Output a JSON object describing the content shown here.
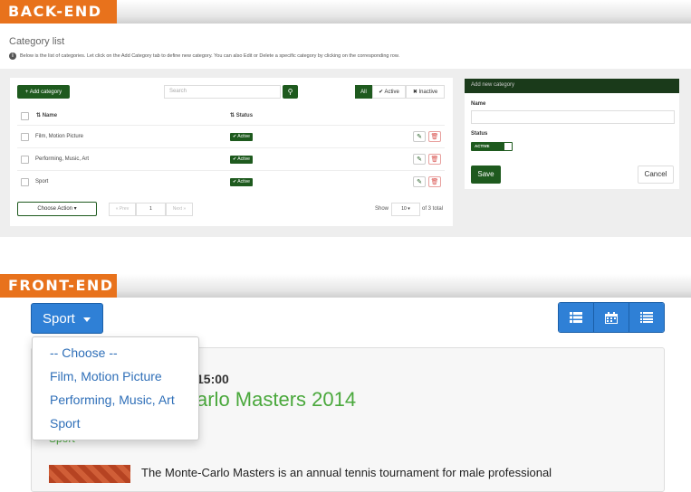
{
  "backend": {
    "banner": "BACK-END",
    "page_title": "Category list",
    "info_text": "Below is the list of categories. Let click on the Add Category tab to define new category. You can also Edit or Delete a specific category by clicking on the corresponding row.",
    "add_button": "+ Add category",
    "search_placeholder": "Search",
    "filters": [
      "All",
      "✔ Active",
      "✖ Inactive"
    ],
    "columns": [
      "Name",
      "Status"
    ],
    "rows": [
      {
        "name": "Film, Motion Picture",
        "status": "✔ Active"
      },
      {
        "name": "Performing, Music, Art",
        "status": "✔ Active"
      },
      {
        "name": "Sport",
        "status": "✔ Active"
      }
    ],
    "choose_action": "Choose Action ▾",
    "prev": "« Prev",
    "page": "1",
    "next": "Next »",
    "show_label": "Show",
    "per_page": "10",
    "total_text": "of 3 total",
    "new_panel": {
      "title": "Add new category",
      "name_label": "Name",
      "status_label": "Status",
      "toggle_text": "ACTIVE",
      "save": "Save",
      "cancel": "Cancel"
    }
  },
  "frontend": {
    "banner": "FRONT-END",
    "selected_category": "Sport",
    "dropdown_items": [
      "-- Choose --",
      "Film, Motion Picture",
      "Performing, Music, Art",
      "Sport"
    ],
    "view_icons": [
      "list-icon",
      "calendar-icon",
      "detail-list-icon"
    ],
    "event": {
      "time": "15:00",
      "title": "arlo Masters 2014",
      "category": "Sport",
      "description": "The Monte-Carlo Masters is an annual tennis tournament for male professional"
    }
  },
  "colors": {
    "banner_orange": "#e8721c",
    "backend_green": "#1e5a1e",
    "frontend_blue": "#2f80d6",
    "event_green": "#4aa83c"
  }
}
